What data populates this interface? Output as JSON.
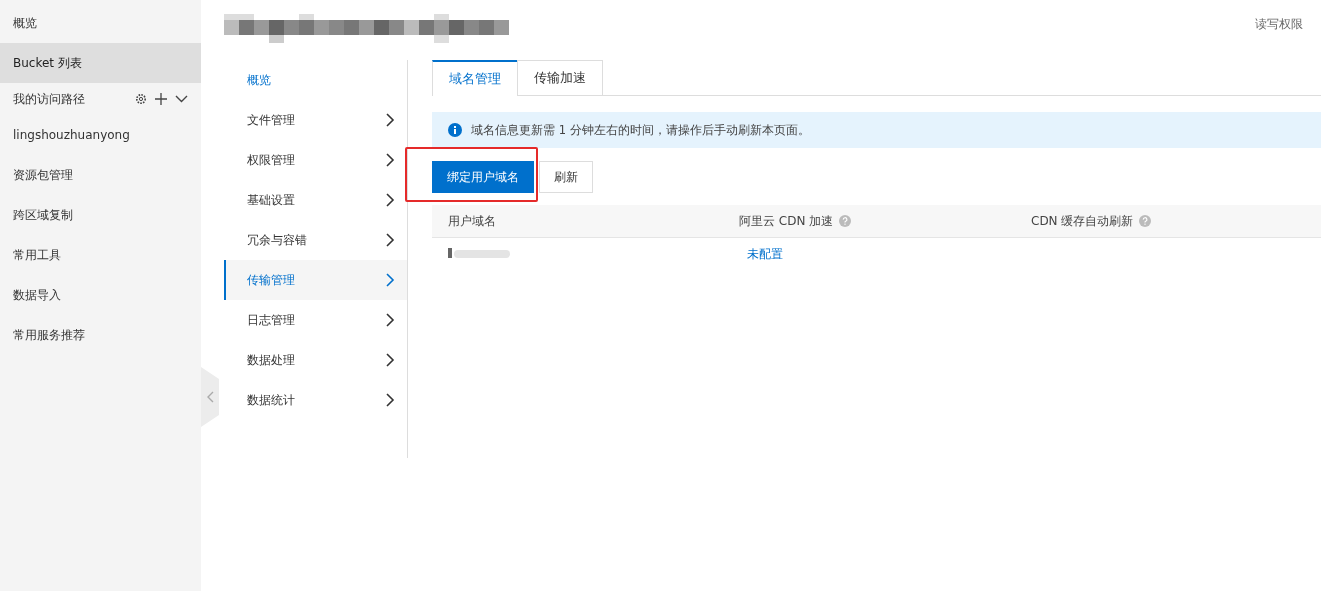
{
  "sidebar": {
    "items": [
      {
        "kind": "item",
        "label": "概览",
        "selected": false
      },
      {
        "kind": "item",
        "label": "Bucket 列表",
        "selected": true
      },
      {
        "kind": "path-header",
        "label": "我的访问路径"
      },
      {
        "kind": "item",
        "label": "lingshouzhuanyong",
        "selected": false
      },
      {
        "kind": "item",
        "label": "资源包管理",
        "selected": false
      },
      {
        "kind": "item",
        "label": "跨区域复制",
        "selected": false
      },
      {
        "kind": "item",
        "label": "常用工具",
        "selected": false
      },
      {
        "kind": "item",
        "label": "数据导入",
        "selected": false
      },
      {
        "kind": "item",
        "label": "常用服务推荐",
        "selected": false
      }
    ]
  },
  "header": {
    "permission": "读写权限"
  },
  "bucket_nav": {
    "items": [
      {
        "label": "概览",
        "kind": "link",
        "selected": false
      },
      {
        "label": "文件管理",
        "kind": "group",
        "selected": false
      },
      {
        "label": "权限管理",
        "kind": "group",
        "selected": false
      },
      {
        "label": "基础设置",
        "kind": "group",
        "selected": false
      },
      {
        "label": "冗余与容错",
        "kind": "group",
        "selected": false
      },
      {
        "label": "传输管理",
        "kind": "group",
        "selected": true
      },
      {
        "label": "日志管理",
        "kind": "group",
        "selected": false
      },
      {
        "label": "数据处理",
        "kind": "group",
        "selected": false
      },
      {
        "label": "数据统计",
        "kind": "group",
        "selected": false
      }
    ]
  },
  "tabs": [
    {
      "label": "域名管理",
      "selected": true
    },
    {
      "label": "传输加速",
      "selected": false
    }
  ],
  "notice": "域名信息更新需 1 分钟左右的时间，请操作后手动刷新本页面。",
  "buttons": [
    {
      "label": "绑定用户域名",
      "kind": "primary",
      "highlighted": true
    },
    {
      "label": "刷新",
      "kind": "default",
      "highlighted": false
    }
  ],
  "table": {
    "columns": [
      {
        "label": "用户域名",
        "kind": "plain"
      },
      {
        "label": "阿里云 CDN 加速",
        "kind": "help"
      },
      {
        "label": "CDN 缓存自动刷新",
        "kind": "help"
      }
    ],
    "rows": [
      {
        "cdn": "未配置"
      }
    ]
  }
}
